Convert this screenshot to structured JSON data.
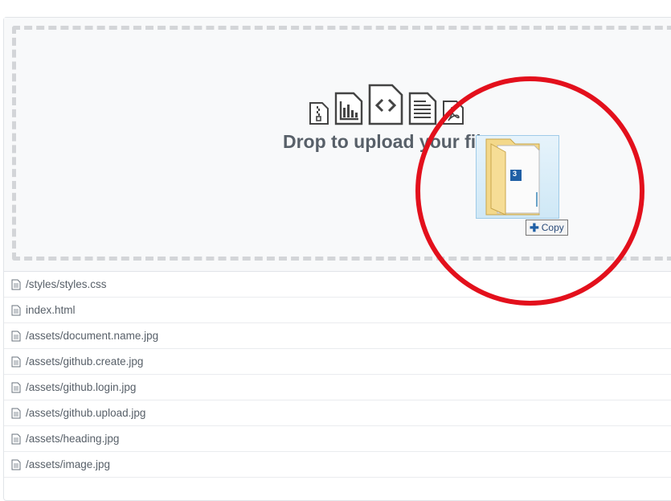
{
  "dropzone": {
    "text": "Drop to upload your files",
    "icons": [
      "zip-file-icon",
      "chart-file-icon",
      "code-file-icon",
      "text-file-icon",
      "pdf-file-icon"
    ]
  },
  "drag": {
    "badge": "3",
    "copy_label": "Copy"
  },
  "files": [
    "/styles/styles.css",
    "index.html",
    "/assets/document.name.jpg",
    "/assets/github.create.jpg",
    "/assets/github.login.jpg",
    "/assets/github.upload.jpg",
    "/assets/heading.jpg",
    "/assets/image.jpg"
  ],
  "colors": {
    "annotation": "#e3101c",
    "dashed_border": "#d3d5d8",
    "text": "#586069"
  }
}
